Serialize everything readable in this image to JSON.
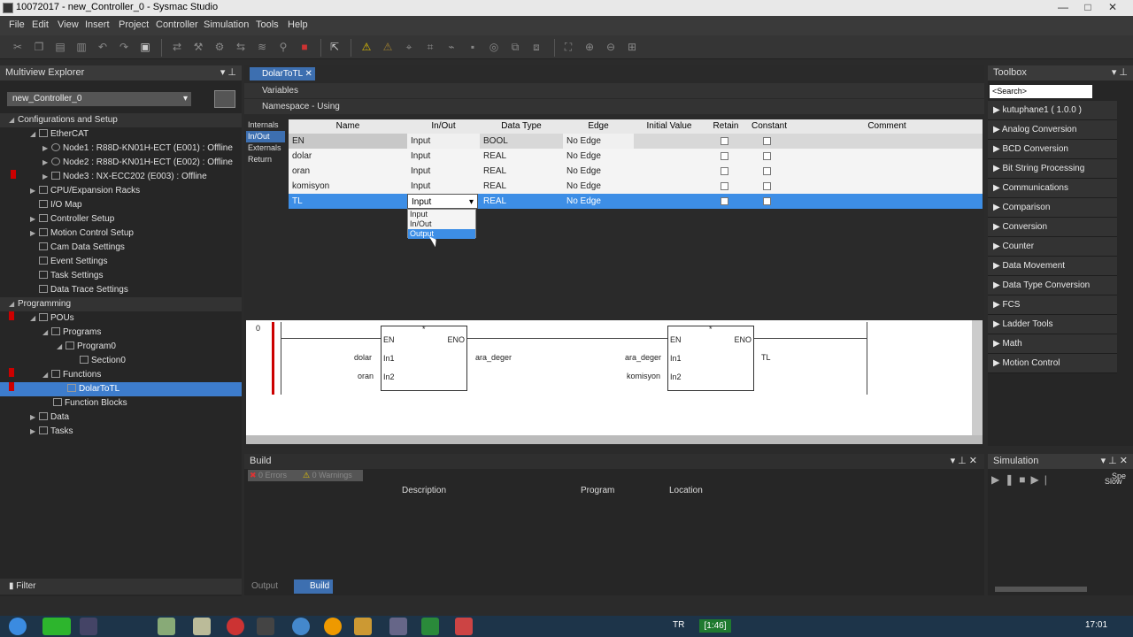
{
  "window": {
    "title": "10072017 - new_Controller_0 - Sysmac Studio",
    "min": "—",
    "max": "□",
    "close": "✕"
  },
  "menu": [
    "File",
    "Edit",
    "View",
    "Insert",
    "Project",
    "Controller",
    "Simulation",
    "Tools",
    "Help"
  ],
  "multiview": {
    "title": "Multiview Explorer",
    "controller": "new_Controller_0"
  },
  "tree": {
    "config": "Configurations and Setup",
    "ethercat": "EtherCAT",
    "node1": "Node1 : R88D-KN01H-ECT (E001) : Offline",
    "node2": "Node2 : R88D-KN01H-ECT (E002) : Offline",
    "node3": "Node3 : NX-ECC202 (E003) : Offline",
    "cpu": "CPU/Expansion Racks",
    "io": "I/O Map",
    "ctrl": "Controller Setup",
    "motion": "Motion Control Setup",
    "cam": "Cam Data Settings",
    "event": "Event Settings",
    "task": "Task Settings",
    "trace": "Data Trace Settings",
    "programming": "Programming",
    "pous": "POUs",
    "programs": "Programs",
    "program0": "Program0",
    "section0": "Section0",
    "functions": "Functions",
    "dolar": "DolarToTL",
    "fblocks": "Function Blocks",
    "data": "Data",
    "tasks": "Tasks"
  },
  "filter": "Filter",
  "editor": {
    "tab": "DolarToTL",
    "variables": "Variables",
    "namespace": "Namespace - Using",
    "sidetabs": [
      "Internals",
      "In/Out",
      "Externals",
      "Return"
    ],
    "columns": [
      "Name",
      "In/Out",
      "Data Type",
      "Edge",
      "Initial Value",
      "Retain",
      "Constant",
      "Comment"
    ],
    "rows": [
      {
        "name": "EN",
        "inout": "Input",
        "type": "BOOL",
        "edge": "No Edge"
      },
      {
        "name": "dolar",
        "inout": "Input",
        "type": "REAL",
        "edge": "No Edge"
      },
      {
        "name": "oran",
        "inout": "Input",
        "type": "REAL",
        "edge": "No Edge"
      },
      {
        "name": "komisyon",
        "inout": "Input",
        "type": "REAL",
        "edge": "No Edge"
      },
      {
        "name": "TL",
        "inout": "Input",
        "type": "REAL",
        "edge": "No Edge"
      }
    ],
    "dropdown": [
      "Input",
      "In/Out",
      "Output"
    ]
  },
  "ladder": {
    "rung": "0",
    "b1": {
      "en": "EN",
      "eno": "ENO",
      "in1": "In1",
      "in2": "In2",
      "a1": "dolar",
      "a2": "oran",
      "out": "ara_deger",
      "star": "*"
    },
    "b2": {
      "en": "EN",
      "eno": "ENO",
      "in1": "In1",
      "in2": "In2",
      "a1": "ara_deger",
      "a2": "komisyon",
      "out": "TL",
      "star": "*"
    }
  },
  "build": {
    "title": "Build",
    "errors": "0 Errors",
    "warnings": "0 Warnings",
    "cols": [
      "Description",
      "Program",
      "Location"
    ],
    "tabs": [
      "Output",
      "Build"
    ]
  },
  "toolbox": {
    "title": "Toolbox",
    "search": "<Search>",
    "items": [
      "kutuphane1 ( 1.0.0 )",
      "Analog Conversion",
      "BCD Conversion",
      "Bit String Processing",
      "Communications",
      "Comparison",
      "Conversion",
      "Counter",
      "Data Movement",
      "Data Type Conversion",
      "FCS",
      "Ladder Tools",
      "Math",
      "Motion Control"
    ]
  },
  "simulation": {
    "title": "Simulation",
    "slow": "Slow",
    "spe": "Spe"
  },
  "taskbar": {
    "lang": "TR",
    "clock": "17:01",
    "timer": "[1:46]"
  }
}
